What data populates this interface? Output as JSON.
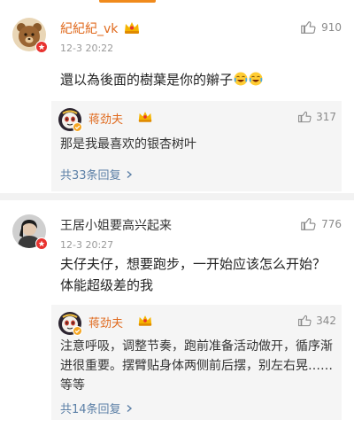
{
  "comments": [
    {
      "username": "紀紀紀_vk",
      "timestamp": "12-3 20:22",
      "likes": "910",
      "text": "還以為後面的樹葉是你的辮子",
      "emojis": [
        "laugh-cry-emoji",
        "laugh-cry-emoji"
      ],
      "reply": {
        "username": "蒋劲夫",
        "likes": "317",
        "text": "那是我最喜欢的银杏树叶",
        "more": "共33条回复"
      }
    },
    {
      "username": "王居小姐要高兴起来",
      "timestamp": "12-3 20:27",
      "likes": "776",
      "text": "夫仔夫仔，想要跑步，一开始应该怎么开始？体能超级差的我",
      "reply": {
        "username": "蒋劲夫",
        "likes": "342",
        "text": "注意呼吸，调整节奏，跑前准备活动做开，循序渐进很重要。摆臂贴身体两侧前后摆，别左右晃……等等",
        "more": "共14条回复"
      }
    }
  ],
  "colors": {
    "accent": "#f08a1c",
    "username": "#e06a1e",
    "link": "#5b7fa6",
    "reply_bg": "#f5f5f5",
    "badge_red": "#e8322f",
    "badge_gold": "#f5a623"
  },
  "icons": {
    "like": "thumbs-up-icon",
    "level": "crown-level-icon",
    "more": "chevron-right-icon"
  }
}
